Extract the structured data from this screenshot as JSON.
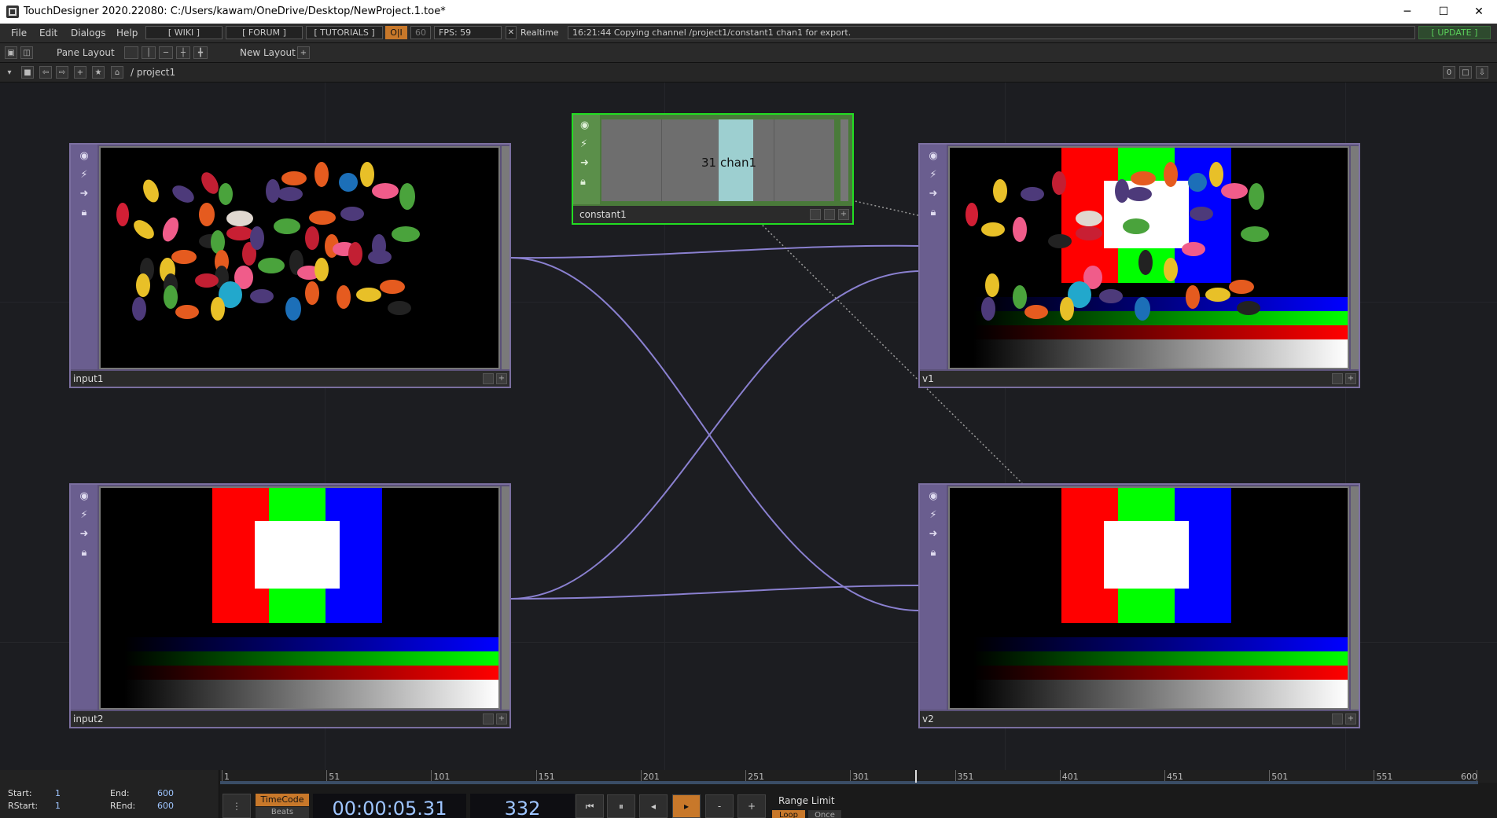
{
  "window": {
    "title": "TouchDesigner 2020.22080: C:/Users/kawam/OneDrive/Desktop/NewProject.1.toe*",
    "minimize": "─",
    "maximize": "☐",
    "close": "✕"
  },
  "menubar": {
    "items": [
      "File",
      "Edit",
      "Dialogs",
      "Help"
    ],
    "wiki": "[ WIKI ]",
    "forum": "[ FORUM ]",
    "tutorials": "[ TUTORIALS ]",
    "oi": "O|I",
    "fps_cap": "60",
    "fps": "FPS:  59",
    "realtime": "Realtime",
    "status": "16:21:44 Copying channel /project1/constant1 chan1 for export.",
    "update": "[ UPDATE ]"
  },
  "toolbar": {
    "pane_layout": "Pane Layout",
    "new_layout": "New Layout"
  },
  "pathbar": {
    "path": "/ project1",
    "counter": "0"
  },
  "nodes": {
    "input1": "input1",
    "input2": "input2",
    "v1": "v1",
    "v2": "v2",
    "constant1": "constant1",
    "constant_value": "31",
    "constant_channel": "chan1"
  },
  "timeline": {
    "ticks": [
      "1",
      "51",
      "101",
      "151",
      "201",
      "251",
      "301",
      "351",
      "401",
      "451",
      "501",
      "551",
      "600"
    ],
    "start_label": "Start:",
    "start": "1",
    "end_label": "End:",
    "end": "600",
    "rstart_label": "RStart:",
    "rstart": "1",
    "rend_label": "REnd:",
    "rend": "600",
    "timecode_label": "TimeCode",
    "beats_label": "Beats",
    "timecode": "00:00:05.31",
    "frame": "332",
    "range_limit": "Range Limit",
    "loop": "Loop",
    "once": "Once",
    "minus": "-",
    "plus": "+",
    "current_frame": 332
  },
  "colors": {
    "accent_orange": "#c8782a",
    "node_purple": "#6a5e8f",
    "selected_green": "#22dd22",
    "wire": "#8a80d0"
  }
}
